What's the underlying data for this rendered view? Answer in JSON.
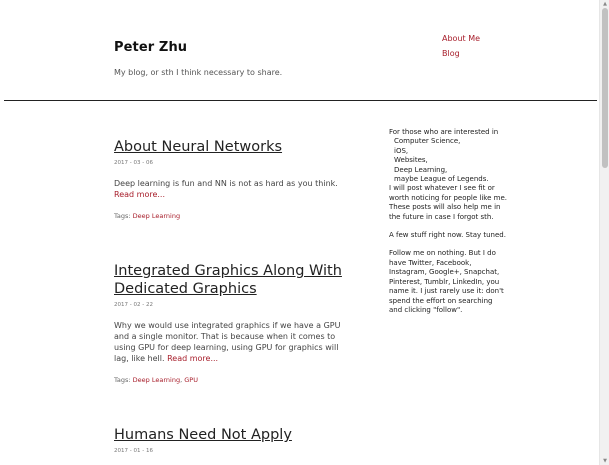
{
  "header": {
    "title": "Peter Zhu",
    "description": "My blog, or sth I think necessary to share.",
    "nav": [
      "About Me",
      "Blog"
    ]
  },
  "posts": [
    {
      "title": "About Neural Networks",
      "date": "2017 - 03 - 06",
      "excerpt": "Deep learning is fun and NN is not as hard as you think.",
      "read_more": "Read more...",
      "tags_label": "Tags:",
      "tags": [
        "Deep Learning"
      ]
    },
    {
      "title_line1": "Integrated Graphics Along With",
      "title_line2": "Dedicated Graphics",
      "date": "2017 - 02 - 22",
      "excerpt": "Why we would use integrated graphics if we have a GPU and a single monitor. That is because when it comes to using GPU for deep learning, using GPU for graphics will lag, like hell.",
      "read_more": "Read more...",
      "tags_label": "Tags:",
      "tags": [
        "Deep Learning",
        "GPU"
      ]
    },
    {
      "title": "Humans Need Not Apply",
      "date": "2017 - 01 - 16"
    }
  ],
  "sidebar": {
    "intro": "For those who are interested in",
    "interests": [
      "Computer Science,",
      "iOS,",
      "Websites,",
      "Deep Learning,",
      "maybe League of Legends."
    ],
    "post_note": "I will post whatever I see fit or worth noticing for people like me. These posts will also help me in the future in case I forgot sth.",
    "stuff_note": "A few stuff right now. Stay tuned.",
    "follow_note": "Follow me on nothing. But I do have Twitter, Facebook, Instagram, Google+, Snapchat, Pinterest, Tumblr, LinkedIn, you name it. I just rarely use it: don't spend the effort on searching and clicking \"follow\"."
  },
  "colors": {
    "link": "#a71d2a",
    "rule": "#222222"
  }
}
